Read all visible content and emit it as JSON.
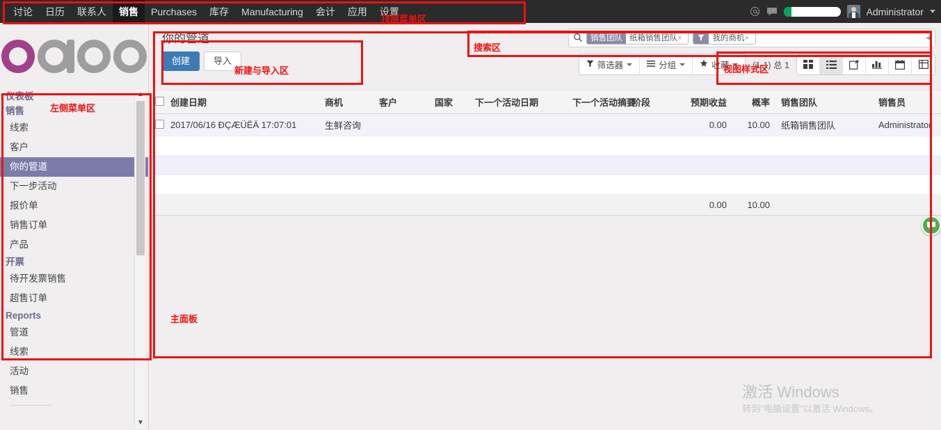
{
  "topbar": {
    "menu_items": [
      {
        "label": "讨论",
        "active": false
      },
      {
        "label": "日历",
        "active": false
      },
      {
        "label": "联系人",
        "active": false
      },
      {
        "label": "销售",
        "active": true
      },
      {
        "label": "Purchases",
        "active": false
      },
      {
        "label": "库存",
        "active": false
      },
      {
        "label": "Manufacturing",
        "active": false
      },
      {
        "label": "会计",
        "active": false
      },
      {
        "label": "应用",
        "active": false
      },
      {
        "label": "设置",
        "active": false
      }
    ],
    "at_icon": "at-icon",
    "chat_icon": "chat-bubble-icon",
    "username": "Administrator"
  },
  "sidebar": {
    "logo_text": "odoo",
    "logo_accent": "#a2408c",
    "logo_gray": "#9e9e9e",
    "sections": [
      {
        "type": "header",
        "label": "仪表板"
      },
      {
        "type": "header",
        "label": "销售"
      },
      {
        "type": "item",
        "label": "线索",
        "selected": false
      },
      {
        "type": "item",
        "label": "客户",
        "selected": false
      },
      {
        "type": "item",
        "label": "你的管道",
        "selected": true
      },
      {
        "type": "item",
        "label": "下一步活动",
        "selected": false
      },
      {
        "type": "item",
        "label": "报价单",
        "selected": false
      },
      {
        "type": "item",
        "label": "销售订单",
        "selected": false
      },
      {
        "type": "item",
        "label": "产品",
        "selected": false
      },
      {
        "type": "header",
        "label": "开票"
      },
      {
        "type": "item",
        "label": "待开发票销售",
        "selected": false
      },
      {
        "type": "item",
        "label": "超售订单",
        "selected": false
      },
      {
        "type": "header",
        "label": "Reports"
      },
      {
        "type": "item",
        "label": "管道",
        "selected": false
      },
      {
        "type": "item",
        "label": "线索",
        "selected": false
      },
      {
        "type": "item",
        "label": "活动",
        "selected": false
      },
      {
        "type": "item",
        "label": "销售",
        "selected": false
      }
    ]
  },
  "control_panel": {
    "page_title": "你的管道",
    "create_label": "创建",
    "import_label": "导入",
    "filter_label": "筛选器",
    "groupby_label": "分组",
    "favorites_label": "收藏",
    "pager_text": "(1-1) 总 1"
  },
  "search": {
    "search_icon": "search-icon",
    "facets": [
      {
        "key": "销售团队",
        "value": "纸箱销售团队",
        "remove": "×",
        "key_is_icon": false
      },
      {
        "key": "filter-funnel-icon",
        "value": "我的商机",
        "remove": "×",
        "key_is_icon": true
      }
    ]
  },
  "view_switcher": {
    "views": [
      {
        "name": "kanban-view-icon",
        "active": false
      },
      {
        "name": "list-view-icon",
        "active": true
      },
      {
        "name": "form-view-icon",
        "active": false
      },
      {
        "name": "graph-view-icon",
        "active": false
      },
      {
        "name": "calendar-view-icon",
        "active": false
      },
      {
        "name": "pivot-view-icon",
        "active": false
      }
    ]
  },
  "table": {
    "columns": [
      {
        "label": "创建日期",
        "align": "left"
      },
      {
        "label": "商机",
        "align": "left"
      },
      {
        "label": "客户",
        "align": "left"
      },
      {
        "label": "国家",
        "align": "left"
      },
      {
        "label": "下一个活动日期",
        "align": "left"
      },
      {
        "label": "下一个活动摘要",
        "align": "left"
      },
      {
        "label": "阶段",
        "align": "left"
      },
      {
        "label": "预期收益",
        "align": "right"
      },
      {
        "label": "概率",
        "align": "right"
      },
      {
        "label": "销售团队",
        "align": "left"
      },
      {
        "label": "销售员",
        "align": "left"
      }
    ],
    "rows": [
      {
        "create_date": "2017/06/16 ĐÇÆÜËÄ 17:07:01",
        "opportunity": "生鲜咨询",
        "customer": "",
        "country": "",
        "next_activity_date": "",
        "next_activity_summary": "",
        "stage": "",
        "expected_revenue": "0.00",
        "probability": "10.00",
        "sales_team": "纸箱销售团队",
        "salesperson": "Administrator"
      }
    ],
    "footer": {
      "expected_revenue_total": "0.00",
      "probability_total": "10.00"
    }
  },
  "annotations": [
    {
      "id": "top",
      "label": "顶层菜单区"
    },
    {
      "id": "left",
      "label": "左侧菜单区"
    },
    {
      "id": "new",
      "label": "新建与导入区"
    },
    {
      "id": "search",
      "label": "搜索区"
    },
    {
      "id": "view",
      "label": "视图样式区"
    },
    {
      "id": "main",
      "label": "主面板"
    }
  ],
  "watermark": {
    "line1": "激活 Windows",
    "line2": "转到\"电脑设置\"以激活 Windows。"
  },
  "float_button": {
    "icon": "chat-help-icon"
  }
}
